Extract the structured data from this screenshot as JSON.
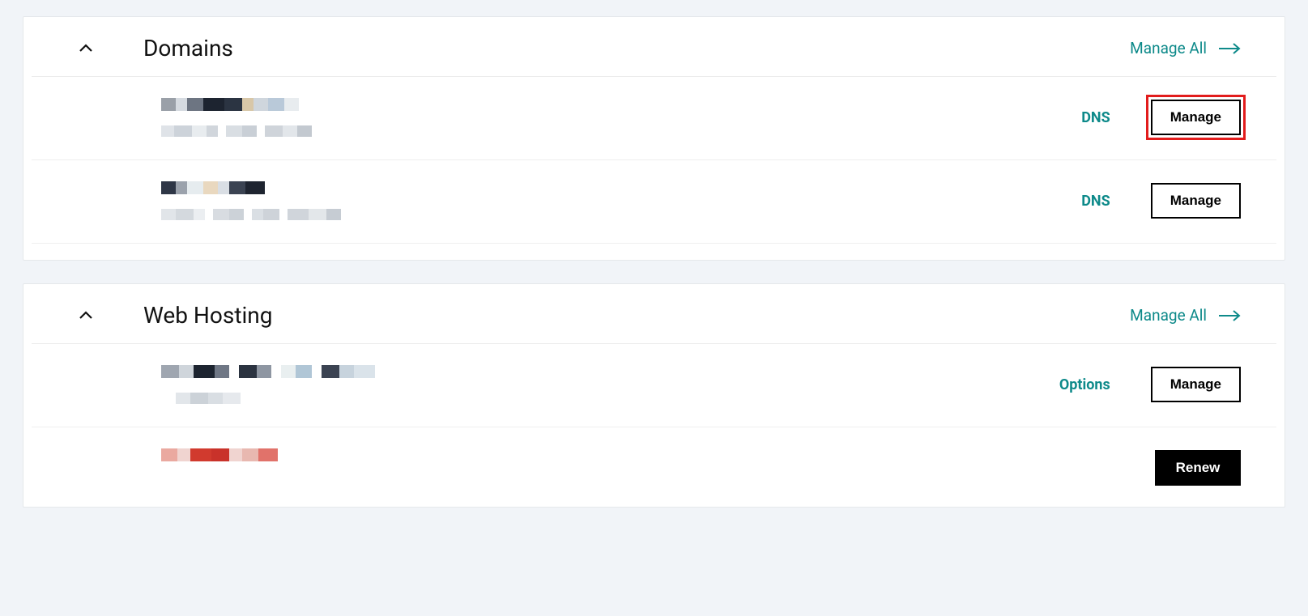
{
  "colors": {
    "teal": "#0e8a8a",
    "highlight": "#e21c1c"
  },
  "sections": {
    "domains": {
      "title": "Domains",
      "manage_all_label": "Manage All",
      "items": [
        {
          "dns_label": "DNS",
          "manage_label": "Manage",
          "highlighted": true
        },
        {
          "dns_label": "DNS",
          "manage_label": "Manage",
          "highlighted": false
        }
      ]
    },
    "web_hosting": {
      "title": "Web Hosting",
      "manage_all_label": "Manage All",
      "items": [
        {
          "options_label": "Options",
          "manage_label": "Manage"
        },
        {
          "renew_label": "Renew"
        }
      ]
    }
  }
}
